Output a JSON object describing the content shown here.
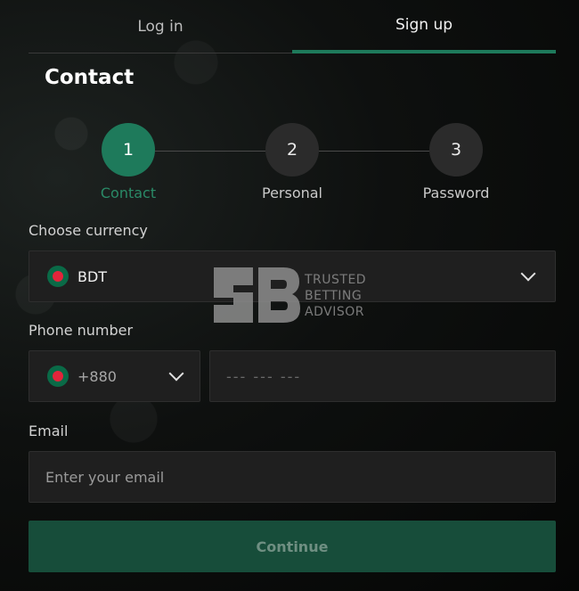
{
  "tabs": [
    {
      "label": "Log in",
      "active": false
    },
    {
      "label": "Sign up",
      "active": true
    }
  ],
  "heading": "Contact",
  "steps": [
    {
      "number": "1",
      "label": "Contact",
      "active": true
    },
    {
      "number": "2",
      "label": "Personal",
      "active": false
    },
    {
      "number": "3",
      "label": "Password",
      "active": false
    }
  ],
  "currency": {
    "label": "Choose currency",
    "value": "BDT",
    "flag_icon": "bangladesh-flag-icon"
  },
  "phone": {
    "label": "Phone number",
    "prefix": "+880",
    "placeholder": "--- --- ---"
  },
  "email": {
    "label": "Email",
    "placeholder": "Enter your email"
  },
  "continue_label": "Continue",
  "watermark": {
    "lines": [
      "TRUSTED",
      "BETTING",
      "ADVISOR"
    ]
  },
  "colors": {
    "accent": "#1e7a5b",
    "button_bg": "#174d3a",
    "field_bg": "#1f1f1f"
  }
}
